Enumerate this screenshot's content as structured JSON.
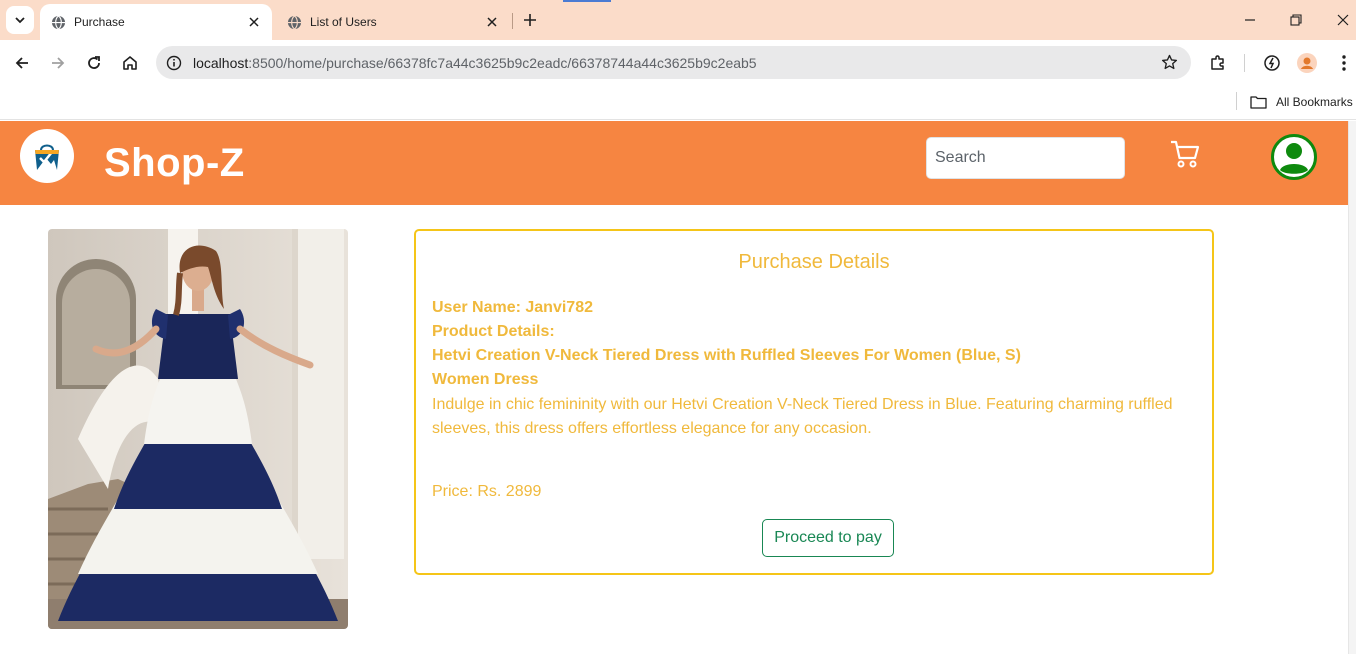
{
  "browser": {
    "tabs": [
      {
        "title": "Purchase",
        "active": true
      },
      {
        "title": "List of Users",
        "active": false
      }
    ],
    "url": {
      "host": "localhost",
      "rest": ":8500/home/purchase/66378fc7a44c3625b9c2eadc/66378744a44c3625b9c2eab5"
    },
    "bookmarks": {
      "all_label": "All Bookmarks"
    }
  },
  "header": {
    "brand": "Shop-Z",
    "search_placeholder": "Search",
    "colors": {
      "header_bg": "#f68541",
      "avatar": "#0e8a0e"
    }
  },
  "purchase": {
    "title": "Purchase Details",
    "user_line": "User Name: Janvi782",
    "product_details_label": "Product Details:",
    "product_name": "Hetvi Creation V-Neck Tiered Dress with Ruffled Sleeves For Women (Blue, S)",
    "category": "Women Dress",
    "description": "Indulge in chic femininity with our Hetvi Creation V-Neck Tiered Dress in Blue. Featuring charming ruffled sleeves, this dress offers effortless elegance for any occasion.",
    "price_line": "Price: Rs. 2899",
    "pay_button": "Proceed to pay",
    "colors": {
      "text": "#f0b93c",
      "border": "#f5c518",
      "button": "#198754"
    }
  }
}
